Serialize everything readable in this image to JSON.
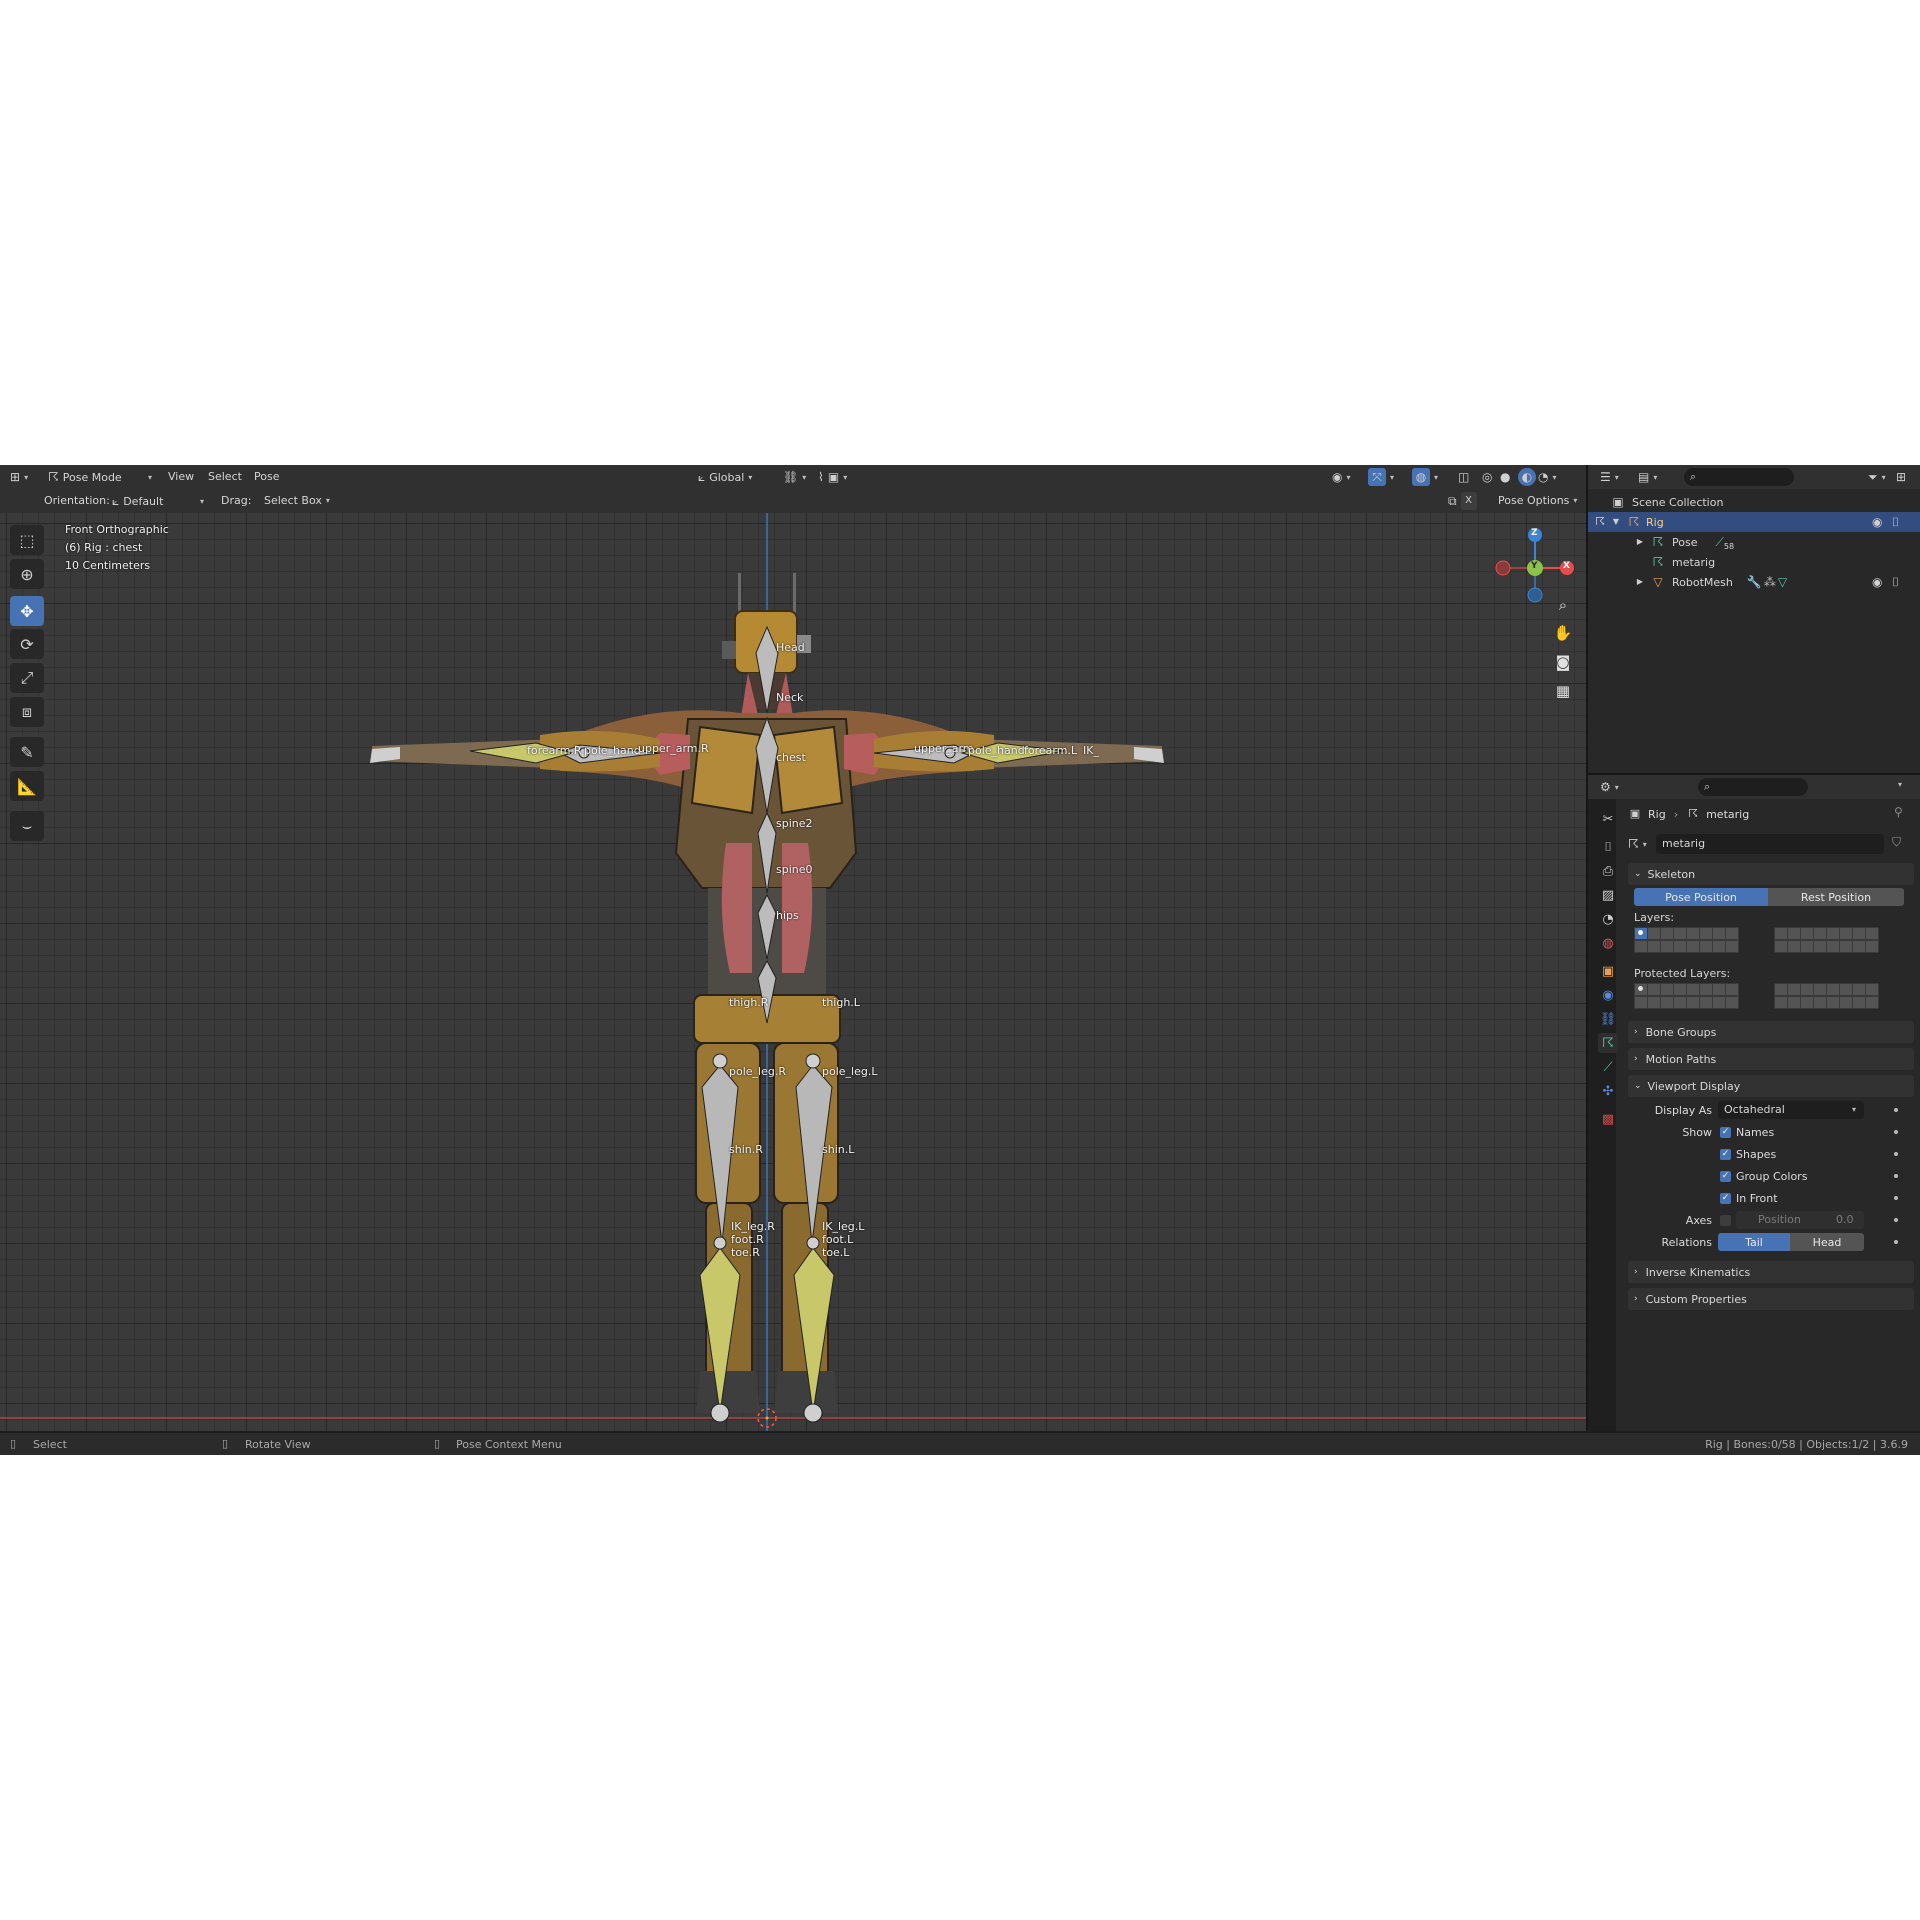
{
  "header": {
    "mode": "Pose Mode",
    "menus": [
      "View",
      "Select",
      "Pose"
    ],
    "transform_orientation": "Global",
    "pose_options": "Pose Options"
  },
  "tool_settings": {
    "orientation_label": "Orientation:",
    "orientation_value": "Default",
    "drag_label": "Drag:",
    "drag_value": "Select Box"
  },
  "viewport": {
    "view_name": "Front Orthographic",
    "object_info": "(6) Rig : chest",
    "scale_info": "10 Centimeters",
    "gizmo_axes": [
      "Z",
      "Y",
      "X"
    ],
    "bone_labels": {
      "head": "Head",
      "neck": "Neck",
      "chest": "chest",
      "spine2": "spine2",
      "spine0": "spine0",
      "hips": "hips",
      "thigh_r": "thigh.R",
      "thigh_l": "thigh.L",
      "pole_leg_r": "pole_leg.R",
      "pole_leg_l": "pole_leg.L",
      "shin_r": "shin.R",
      "shin_l": "shin.L",
      "ik_leg_r": "IK_leg.R",
      "ik_leg_l": "IK_leg.L",
      "foot_r": "foot.R",
      "foot_l": "foot.L",
      "toe_r": "toe.R",
      "toe_l": "toe.L",
      "forearm_r": "forearm.R",
      "pole_hand_r": "pole_hand",
      "upper_arm_r": "upper_arm.R",
      "upper_arm_l": "upper_arm",
      "pole_hand_l": "pole_hand",
      "forearm_l": "forearm.L",
      "ik_l": "IK_"
    }
  },
  "outliner": {
    "scene_collection": "Scene Collection",
    "items": [
      {
        "name": "Rig",
        "selected": true
      },
      {
        "name": "Pose",
        "badge": "58"
      },
      {
        "name": "metarig"
      },
      {
        "name": "RobotMesh"
      }
    ]
  },
  "properties": {
    "breadcrumb_object": "Rig",
    "breadcrumb_data": "metarig",
    "datablock_name": "metarig",
    "skeleton": {
      "title": "Skeleton",
      "pose_position": "Pose Position",
      "rest_position": "Rest Position",
      "layers_label": "Layers:",
      "protected_layers_label": "Protected Layers:"
    },
    "bone_groups": "Bone Groups",
    "motion_paths": "Motion Paths",
    "viewport_display": {
      "title": "Viewport Display",
      "display_as_label": "Display As",
      "display_as_value": "Octahedral",
      "show_label": "Show",
      "names": "Names",
      "shapes": "Shapes",
      "group_colors": "Group Colors",
      "in_front": "In Front",
      "axes_label": "Axes",
      "position_label": "Position",
      "position_value": "0.0",
      "relations_label": "Relations",
      "tail": "Tail",
      "head": "Head"
    },
    "inverse_kinematics": "Inverse Kinematics",
    "custom_properties": "Custom Properties"
  },
  "statusbar": {
    "select": "Select",
    "rotate_view": "Rotate View",
    "context_menu": "Pose Context Menu",
    "stats": "Rig | Bones:0/58 | Objects:1/2 | 3.6.9"
  },
  "colors": {
    "accent": "#4772b3",
    "x_axis": "#e44d4d",
    "y_axis": "#8bc34a",
    "z_axis": "#3b84d6",
    "bone_selected": "#c8c86a"
  }
}
